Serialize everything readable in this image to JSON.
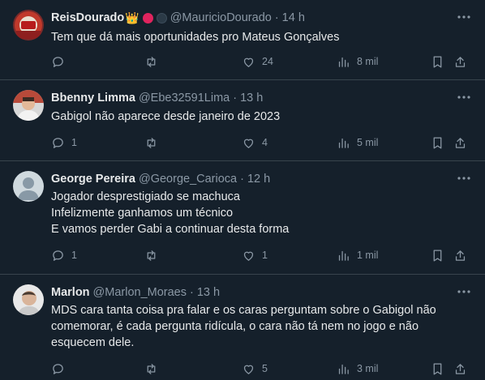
{
  "tweets": [
    {
      "name": "ReisDourado",
      "handle": "@MauricioDourado",
      "sep": "·",
      "time": "14 h",
      "crown": "👑",
      "lines": [
        "Tem que dá mais oportunidades pro Mateus Gonçalves"
      ],
      "replies": "",
      "retweets": "",
      "likes": "24",
      "views": "8 mil"
    },
    {
      "name": "Bbenny Limma",
      "handle": "@Ebe32591Lima",
      "sep": "·",
      "time": "13 h",
      "lines": [
        "Gabigol não aparece desde janeiro de 2023"
      ],
      "replies": "1",
      "retweets": "",
      "likes": "4",
      "views": "5 mil"
    },
    {
      "name": "George Pereira",
      "handle": "@George_Carioca",
      "sep": "·",
      "time": "12 h",
      "lines": [
        "Jogador desprestigiado se machuca",
        "Infelizmente ganhamos um técnico",
        "E vamos perder Gabi a continuar desta forma"
      ],
      "replies": "1",
      "retweets": "",
      "likes": "1",
      "views": "1 mil"
    },
    {
      "name": "Marlon",
      "handle": "@Marlon_Moraes",
      "sep": "·",
      "time": "13 h",
      "lines": [
        "MDS cara tanta coisa pra falar e os caras perguntam sobre o Gabigol não",
        "comemorar, é cada pergunta ridícula, o cara não tá nem no jogo e não",
        "esquecem dele."
      ],
      "replies": "",
      "retweets": "",
      "likes": "5",
      "views": "3 mil"
    }
  ],
  "icons": {
    "more": "more-icon",
    "reply": "reply-icon",
    "retweet": "retweet-icon",
    "like": "like-icon",
    "views": "views-icon",
    "bookmark": "bookmark-icon",
    "share": "share-icon"
  },
  "colors": {
    "background": "#15202b",
    "text": "#e7e9ea",
    "muted": "#8b98a5",
    "divider": "#38444d",
    "badge_red": "#e0245e"
  }
}
